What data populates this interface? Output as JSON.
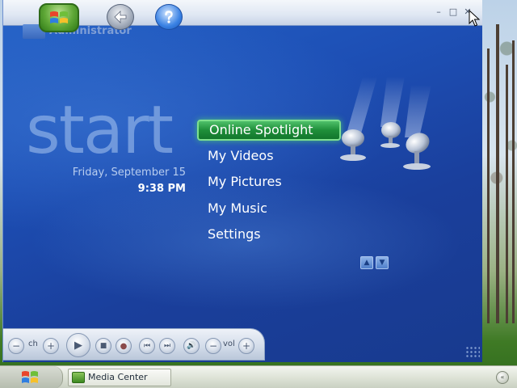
{
  "window": {
    "user_name": "Administrator",
    "controls": {
      "minimize": "–",
      "maximize": "□",
      "close": "✕"
    }
  },
  "top_buttons": {
    "start_orb_icon": "windows-logo-icon",
    "back_icon": "back-arrow-icon",
    "help_icon": "help-icon"
  },
  "home": {
    "title": "start",
    "date": "Friday, September 15",
    "time": "9:38 PM"
  },
  "menu": {
    "items": [
      {
        "label": "Online Spotlight",
        "focused": true
      },
      {
        "label": "My Videos",
        "focused": false
      },
      {
        "label": "My Pictures",
        "focused": false
      },
      {
        "label": "My Music",
        "focused": false
      },
      {
        "label": "Settings",
        "focused": false
      }
    ],
    "focus_color": "#1f8f3a"
  },
  "scroll": {
    "up_icon": "▲",
    "down_icon": "▼"
  },
  "transport": {
    "ch_label": "ch",
    "vol_label": "vol",
    "minus": "−",
    "plus": "+",
    "play": "▶",
    "stop": "■",
    "record": "●",
    "prev": "⏮",
    "next": "⏭",
    "mute": "🔊"
  },
  "taskbar": {
    "task_label": "Media Center"
  },
  "colors": {
    "background_blue": "#1d4fb5",
    "accent_green": "#1f8f3a"
  }
}
